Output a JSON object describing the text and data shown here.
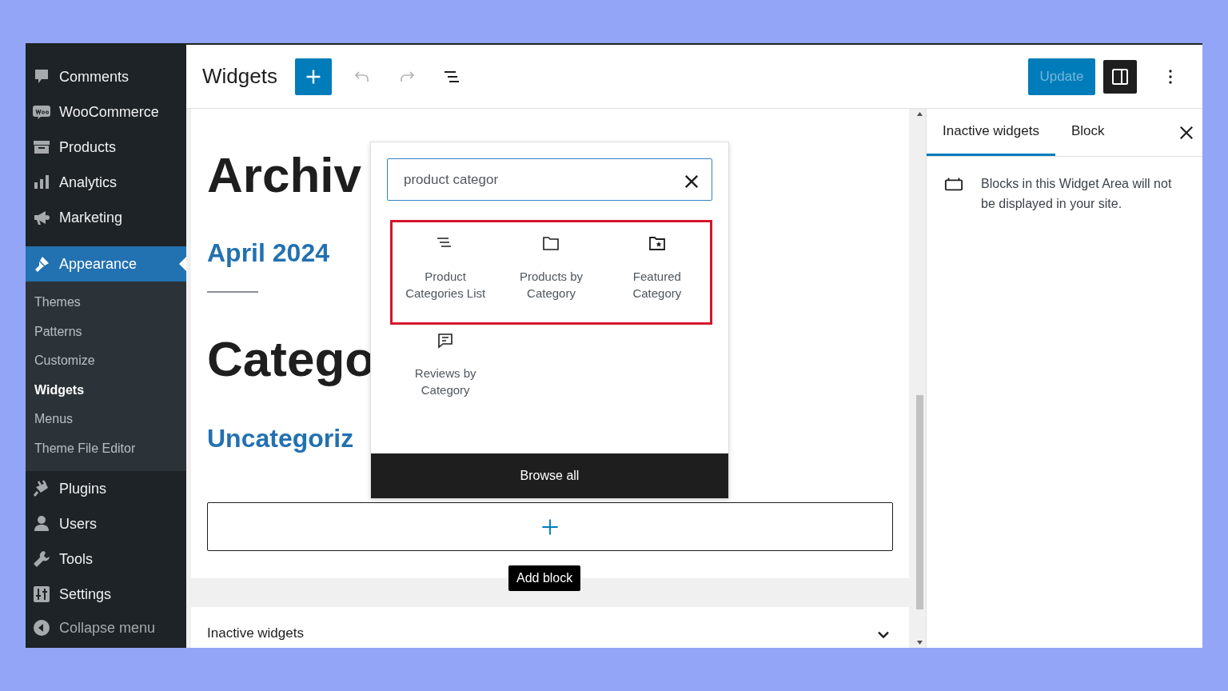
{
  "sidebar": {
    "items": [
      {
        "label": "Comments",
        "selected": false
      },
      {
        "label": "WooCommerce",
        "selected": false
      },
      {
        "label": "Products",
        "selected": false
      },
      {
        "label": "Analytics",
        "selected": false
      },
      {
        "label": "Marketing",
        "selected": false
      },
      {
        "label": "Appearance",
        "selected": true,
        "children": [
          {
            "label": "Themes",
            "selected": false
          },
          {
            "label": "Patterns",
            "selected": false
          },
          {
            "label": "Customize",
            "selected": false
          },
          {
            "label": "Widgets",
            "selected": true
          },
          {
            "label": "Menus",
            "selected": false
          },
          {
            "label": "Theme File Editor",
            "selected": false
          }
        ]
      },
      {
        "label": "Plugins",
        "selected": false
      },
      {
        "label": "Users",
        "selected": false
      },
      {
        "label": "Tools",
        "selected": false
      },
      {
        "label": "Settings",
        "selected": false
      }
    ],
    "collapse_label": "Collapse menu"
  },
  "header": {
    "title": "Widgets",
    "undo_disabled": true,
    "redo_disabled": true,
    "update_label": "Update",
    "update_disabled": true
  },
  "canvas": {
    "blocks": [
      {
        "kind": "title",
        "text": "Archiv"
      },
      {
        "kind": "link",
        "text": "April 2024"
      },
      {
        "kind": "separator"
      },
      {
        "kind": "title",
        "text": "Catego"
      },
      {
        "kind": "link",
        "text": "Uncategoriz"
      }
    ],
    "appender_tooltip": "Add block",
    "inactive_area": {
      "label": "Inactive widgets",
      "expanded": false
    }
  },
  "inserter": {
    "search": {
      "value": "product categor"
    },
    "results": [
      {
        "label": "Product Categories List",
        "highlighted": true
      },
      {
        "label": "Products by Category",
        "highlighted": true
      },
      {
        "label": "Featured Category",
        "highlighted": true
      },
      {
        "label": "Reviews by Category",
        "highlighted": false
      }
    ],
    "browse_label": "Browse all"
  },
  "panel": {
    "tabs": [
      {
        "label": "Inactive widgets",
        "selected": true
      },
      {
        "label": "Block",
        "selected": false
      }
    ],
    "description": "Blocks in this Widget Area will not be displayed in your site."
  }
}
